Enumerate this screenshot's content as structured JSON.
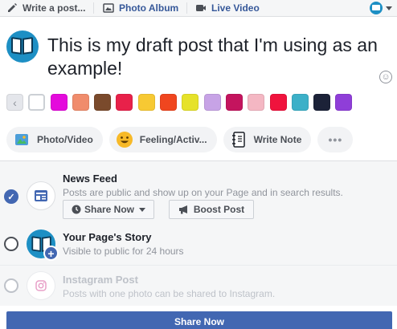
{
  "tabs": {
    "write_post": "Write a post...",
    "photo_album": "Photo Album",
    "live_video": "Live Video"
  },
  "composer": {
    "text": "This is my draft post that I'm using as an example!"
  },
  "swatches": {
    "colors": [
      "#ffffff",
      "#e40bdc",
      "#f08c6c",
      "#7a4a2c",
      "#e8214a",
      "#f7c933",
      "#f0461f",
      "#e6e22a",
      "#c7a3e6",
      "#c4145e",
      "#f4b7c3",
      "#f0133d",
      "#3cb0c8",
      "#1c2238",
      "#8f3ed8"
    ]
  },
  "actions": {
    "photo_video": "Photo/Video",
    "feeling": "Feeling/Activ...",
    "write_note": "Write Note",
    "more": "•••"
  },
  "destinations": {
    "news_feed": {
      "title": "News Feed",
      "subtitle": "Posts are public and show up on your Page and in search results.",
      "share_now": "Share Now",
      "boost_post": "Boost Post"
    },
    "story": {
      "title": "Your Page's Story",
      "subtitle": "Visible to public for 24 hours"
    },
    "instagram": {
      "title": "Instagram Post",
      "subtitle": "Posts with one photo can be shared to Instagram."
    }
  },
  "footer": {
    "share_button": "Share Now"
  },
  "accent_color": "#4267b2"
}
